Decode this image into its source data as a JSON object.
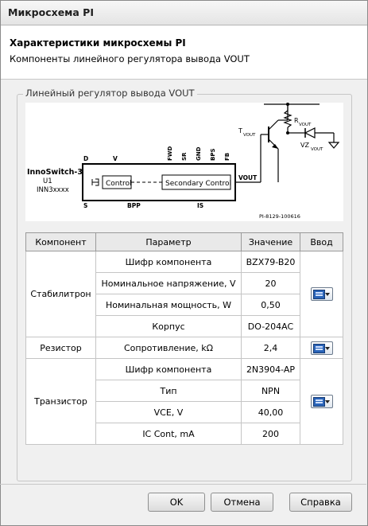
{
  "window": {
    "title": "Микросхема PI"
  },
  "header": {
    "title": "Характеристики микросхемы PI",
    "subtitle": "Компоненты линейного регулятора вывода VOUT"
  },
  "group": {
    "label": "Линейный регулятор вывода VOUT"
  },
  "diagram": {
    "chip_name": "InnoSwitch-3",
    "chip_ref": "U1",
    "chip_part": "INN3xxxx",
    "block_left": "Control",
    "block_right": "Secondary Control",
    "pins": {
      "d": "D",
      "v": "V",
      "s": "S",
      "bpp": "BPP",
      "is": "IS",
      "fwd": "FWD",
      "sr": "SR",
      "gnd": "GND",
      "bps": "BPS",
      "fb": "FB",
      "vout": "VOUT"
    },
    "r_label": "R",
    "r_sub": "VOUT",
    "t_label": "T",
    "t_sub": "VOUT",
    "vz_label": "VZ",
    "vz_sub": "VOUT",
    "figure_id": "PI-8129-100616"
  },
  "table": {
    "headers": {
      "component": "Компонент",
      "parameter": "Параметр",
      "value": "Значение",
      "input": "Ввод"
    },
    "groups": [
      {
        "name": "Стабилитрон",
        "rows": [
          {
            "param": "Шифр компонента",
            "value": "BZX79-B20"
          },
          {
            "param": "Номинальное напряжение, V",
            "value": "20"
          },
          {
            "param": "Номинальная мощность, W",
            "value": "0,50"
          },
          {
            "param": "Корпус",
            "value": "DO-204AC"
          }
        ]
      },
      {
        "name": "Резистор",
        "rows": [
          {
            "param": "Сопротивление, kΩ",
            "value": "2,4"
          }
        ]
      },
      {
        "name": "Транзистор",
        "rows": [
          {
            "param": "Шифр компонента",
            "value": "2N3904-AP"
          },
          {
            "param": "Тип",
            "value": "NPN"
          },
          {
            "param": "VCE, V",
            "value": "40,00"
          },
          {
            "param": "IC Cont, mA",
            "value": "200"
          }
        ]
      }
    ]
  },
  "buttons": {
    "ok": "OK",
    "cancel": "Отмена",
    "help": "Справка"
  }
}
